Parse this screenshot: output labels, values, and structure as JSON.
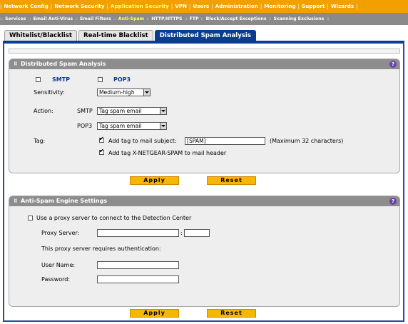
{
  "top_nav": [
    {
      "label": "Network Config",
      "active": false
    },
    {
      "label": "Network Security",
      "active": false
    },
    {
      "label": "Application Security",
      "active": true
    },
    {
      "label": "VPN",
      "active": false
    },
    {
      "label": "Users",
      "active": false
    },
    {
      "label": "Administration",
      "active": false
    },
    {
      "label": "Monitoring",
      "active": false
    },
    {
      "label": "Support",
      "active": false
    },
    {
      "label": "Wizards",
      "active": false
    }
  ],
  "sub_nav": [
    {
      "label": "Services",
      "active": false
    },
    {
      "label": "Email Anti-Virus",
      "active": false
    },
    {
      "label": "Email Filters",
      "active": false
    },
    {
      "label": "Anti-Spam",
      "active": true
    },
    {
      "label": "HTTP/HTTPS",
      "active": false
    },
    {
      "label": "FTP",
      "active": false
    },
    {
      "label": "Block/Accept Exceptions",
      "active": false
    },
    {
      "label": "Scanning Exclusions",
      "active": false
    }
  ],
  "tabs": [
    {
      "label": "Whitelist/Blacklist",
      "active": false
    },
    {
      "label": "Real-time Blacklist",
      "active": false
    },
    {
      "label": "Distributed Spam Analysis",
      "active": true
    }
  ],
  "dsa": {
    "title": "Distributed Spam Analysis",
    "smtp_label": "SMTP",
    "pop3_label": "POP3",
    "smtp_checked": false,
    "pop3_checked": false,
    "sensitivity_label": "Sensitivity:",
    "sensitivity_value": "Medium-high",
    "action_label": "Action:",
    "action_smtp_label": "SMTP",
    "action_smtp_value": "Tag spam email",
    "action_pop3_label": "POP3",
    "action_pop3_value": "Tag spam email",
    "tag_label": "Tag:",
    "tag_subject_label": "Add tag to mail subject:",
    "tag_subject_value": "[SPAM]",
    "tag_subject_checked": true,
    "tag_subject_hint": "(Maximum 32 characters)",
    "tag_header_label": "Add tag X-NETGEAR-SPAM to mail header",
    "tag_header_checked": true
  },
  "buttons": {
    "apply": "Apply",
    "reset": "Reset"
  },
  "engine": {
    "title": "Anti-Spam Engine Settings",
    "proxy_checkbox_label": "Use a proxy server to connect to the Detection Center",
    "proxy_checked": false,
    "proxy_server_label": "Proxy Server:",
    "proxy_server_value": "",
    "proxy_port_value": "",
    "colon": ":",
    "auth_note": "This proxy server requires authentication:",
    "username_label": "User Name:",
    "username_value": "",
    "password_label": "Password:",
    "password_value": ""
  },
  "icons": {
    "help": "help-icon",
    "grip": "grip-icon",
    "dropdown": "chevron-down-icon"
  },
  "colors": {
    "nav_orange": "#f2a000",
    "subnav_grey": "#8a8a8a",
    "tab_active": "#0a3d8f",
    "button_yellow": "#f7b600",
    "help_purple": "#6a44a8"
  }
}
